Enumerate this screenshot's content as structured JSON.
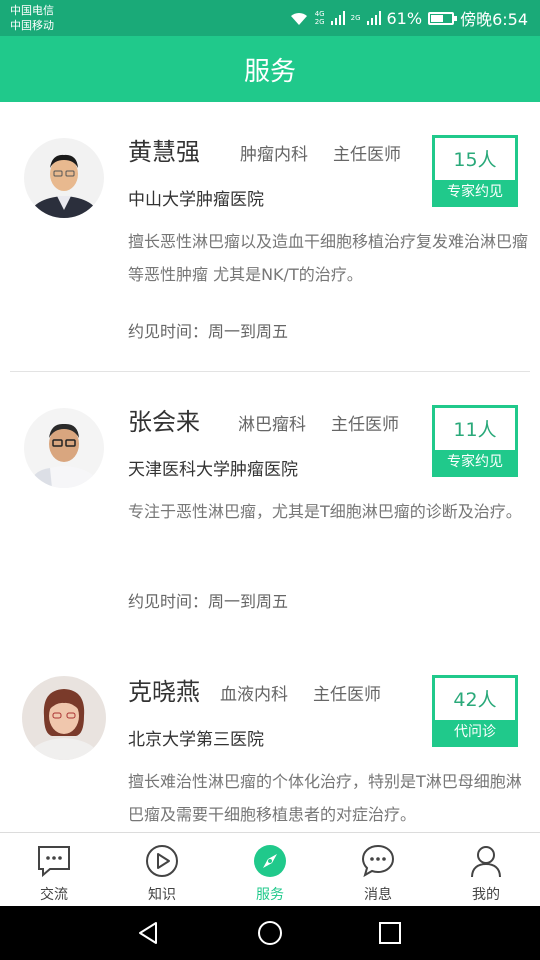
{
  "status_bar": {
    "carrier1": "中国电信",
    "carrier2": "中国移动",
    "net1": "4G",
    "net1_sub": "2G",
    "net2": "2G",
    "battery_percent": "61%",
    "battery_level": 0.61,
    "time": "傍晚6:54"
  },
  "header": {
    "title": "服务"
  },
  "doctors": [
    {
      "name": "黄慧强",
      "dept": "肿瘤内科",
      "title": "主任医师",
      "hospital": "中山大学肿瘤医院",
      "desc": "擅长恶性淋巴瘤以及造血干细胞移植治疗复发难治淋巴瘤等恶性肿瘤 尤其是NK/T的治疗。",
      "time_label": "约见时间：",
      "time_value": "周一到周五",
      "count": "15人",
      "badge": "专家约见"
    },
    {
      "name": "张会来",
      "dept": "淋巴瘤科",
      "title": "主任医师",
      "hospital": "天津医科大学肿瘤医院",
      "desc": "专注于恶性淋巴瘤，尤其是T细胞淋巴瘤的诊断及治疗。",
      "time_label": "约见时间：",
      "time_value": "周一到周五",
      "count": "11人",
      "badge": "专家约见"
    },
    {
      "name": "克晓燕",
      "dept": "血液内科",
      "title": "主任医师",
      "hospital": "北京大学第三医院",
      "desc": "擅长难治性淋巴瘤的个体化治疗，特别是T淋巴母细胞淋巴瘤及需要干细胞移植患者的对症治疗。",
      "count": "42人",
      "badge": "代问诊"
    }
  ],
  "tabs": [
    {
      "label": "交流",
      "icon": "chat-bubble-icon"
    },
    {
      "label": "知识",
      "icon": "play-circle-icon"
    },
    {
      "label": "服务",
      "icon": "compass-icon"
    },
    {
      "label": "消息",
      "icon": "message-icon"
    },
    {
      "label": "我的",
      "icon": "person-icon"
    }
  ],
  "active_tab": "服务",
  "colors": {
    "brand": "#20c98b",
    "status_bar": "#1aaa78",
    "text_dark": "#333333",
    "text_muted": "#777777"
  }
}
